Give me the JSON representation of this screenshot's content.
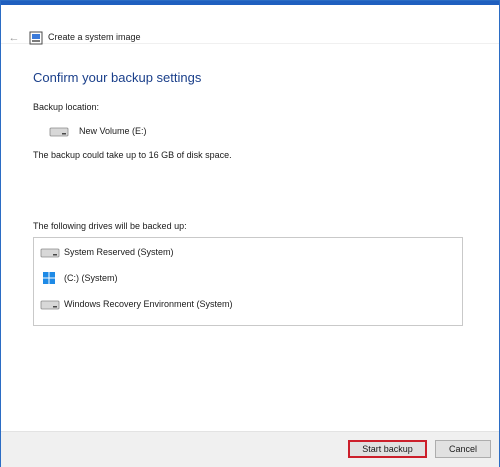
{
  "window": {
    "title": "Create a system image"
  },
  "header": {
    "heading": "Confirm your backup settings"
  },
  "backup_location": {
    "label": "Backup location:",
    "drive": "New Volume (E:)"
  },
  "space_message": "The backup could take up to 16 GB of disk space.",
  "drives": {
    "label": "The following drives will be backed up:",
    "items": [
      {
        "label": "System Reserved (System)",
        "icon": "drive-icon"
      },
      {
        "label": "(C:) (System)",
        "icon": "windows-drive-icon"
      },
      {
        "label": "Windows Recovery Environment (System)",
        "icon": "drive-icon"
      }
    ]
  },
  "buttons": {
    "start": "Start backup",
    "cancel": "Cancel"
  },
  "colors": {
    "heading": "#1a3f8a",
    "highlight": "#cc1f2b",
    "accent": "#1f5fbf"
  }
}
